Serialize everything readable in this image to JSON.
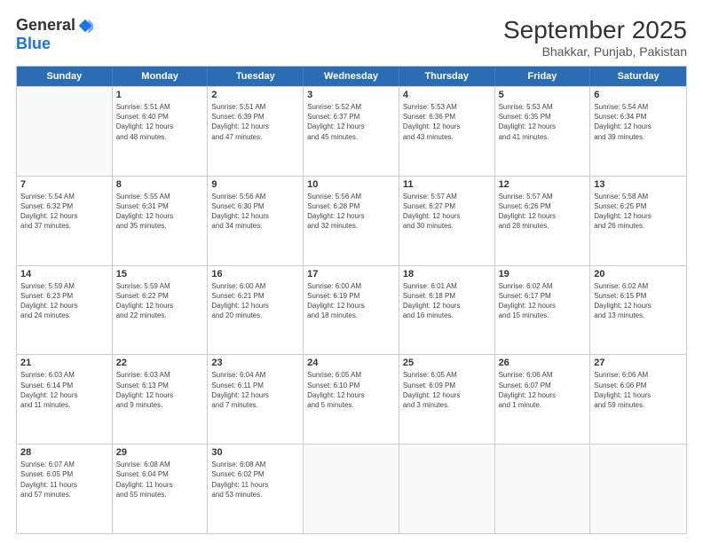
{
  "header": {
    "logo_general": "General",
    "logo_blue": "Blue",
    "month_title": "September 2025",
    "subtitle": "Bhakkar, Punjab, Pakistan"
  },
  "days_of_week": [
    "Sunday",
    "Monday",
    "Tuesday",
    "Wednesday",
    "Thursday",
    "Friday",
    "Saturday"
  ],
  "weeks": [
    [
      {
        "day": "",
        "lines": []
      },
      {
        "day": "1",
        "lines": [
          "Sunrise: 5:51 AM",
          "Sunset: 6:40 PM",
          "Daylight: 12 hours",
          "and 48 minutes."
        ]
      },
      {
        "day": "2",
        "lines": [
          "Sunrise: 5:51 AM",
          "Sunset: 6:39 PM",
          "Daylight: 12 hours",
          "and 47 minutes."
        ]
      },
      {
        "day": "3",
        "lines": [
          "Sunrise: 5:52 AM",
          "Sunset: 6:37 PM",
          "Daylight: 12 hours",
          "and 45 minutes."
        ]
      },
      {
        "day": "4",
        "lines": [
          "Sunrise: 5:53 AM",
          "Sunset: 6:36 PM",
          "Daylight: 12 hours",
          "and 43 minutes."
        ]
      },
      {
        "day": "5",
        "lines": [
          "Sunrise: 5:53 AM",
          "Sunset: 6:35 PM",
          "Daylight: 12 hours",
          "and 41 minutes."
        ]
      },
      {
        "day": "6",
        "lines": [
          "Sunrise: 5:54 AM",
          "Sunset: 6:34 PM",
          "Daylight: 12 hours",
          "and 39 minutes."
        ]
      }
    ],
    [
      {
        "day": "7",
        "lines": [
          "Sunrise: 5:54 AM",
          "Sunset: 6:32 PM",
          "Daylight: 12 hours",
          "and 37 minutes."
        ]
      },
      {
        "day": "8",
        "lines": [
          "Sunrise: 5:55 AM",
          "Sunset: 6:31 PM",
          "Daylight: 12 hours",
          "and 35 minutes."
        ]
      },
      {
        "day": "9",
        "lines": [
          "Sunrise: 5:56 AM",
          "Sunset: 6:30 PM",
          "Daylight: 12 hours",
          "and 34 minutes."
        ]
      },
      {
        "day": "10",
        "lines": [
          "Sunrise: 5:56 AM",
          "Sunset: 6:28 PM",
          "Daylight: 12 hours",
          "and 32 minutes."
        ]
      },
      {
        "day": "11",
        "lines": [
          "Sunrise: 5:57 AM",
          "Sunset: 6:27 PM",
          "Daylight: 12 hours",
          "and 30 minutes."
        ]
      },
      {
        "day": "12",
        "lines": [
          "Sunrise: 5:57 AM",
          "Sunset: 6:26 PM",
          "Daylight: 12 hours",
          "and 28 minutes."
        ]
      },
      {
        "day": "13",
        "lines": [
          "Sunrise: 5:58 AM",
          "Sunset: 6:25 PM",
          "Daylight: 12 hours",
          "and 26 minutes."
        ]
      }
    ],
    [
      {
        "day": "14",
        "lines": [
          "Sunrise: 5:59 AM",
          "Sunset: 6:23 PM",
          "Daylight: 12 hours",
          "and 24 minutes."
        ]
      },
      {
        "day": "15",
        "lines": [
          "Sunrise: 5:59 AM",
          "Sunset: 6:22 PM",
          "Daylight: 12 hours",
          "and 22 minutes."
        ]
      },
      {
        "day": "16",
        "lines": [
          "Sunrise: 6:00 AM",
          "Sunset: 6:21 PM",
          "Daylight: 12 hours",
          "and 20 minutes."
        ]
      },
      {
        "day": "17",
        "lines": [
          "Sunrise: 6:00 AM",
          "Sunset: 6:19 PM",
          "Daylight: 12 hours",
          "and 18 minutes."
        ]
      },
      {
        "day": "18",
        "lines": [
          "Sunrise: 6:01 AM",
          "Sunset: 6:18 PM",
          "Daylight: 12 hours",
          "and 16 minutes."
        ]
      },
      {
        "day": "19",
        "lines": [
          "Sunrise: 6:02 AM",
          "Sunset: 6:17 PM",
          "Daylight: 12 hours",
          "and 15 minutes."
        ]
      },
      {
        "day": "20",
        "lines": [
          "Sunrise: 6:02 AM",
          "Sunset: 6:15 PM",
          "Daylight: 12 hours",
          "and 13 minutes."
        ]
      }
    ],
    [
      {
        "day": "21",
        "lines": [
          "Sunrise: 6:03 AM",
          "Sunset: 6:14 PM",
          "Daylight: 12 hours",
          "and 11 minutes."
        ]
      },
      {
        "day": "22",
        "lines": [
          "Sunrise: 6:03 AM",
          "Sunset: 6:13 PM",
          "Daylight: 12 hours",
          "and 9 minutes."
        ]
      },
      {
        "day": "23",
        "lines": [
          "Sunrise: 6:04 AM",
          "Sunset: 6:11 PM",
          "Daylight: 12 hours",
          "and 7 minutes."
        ]
      },
      {
        "day": "24",
        "lines": [
          "Sunrise: 6:05 AM",
          "Sunset: 6:10 PM",
          "Daylight: 12 hours",
          "and 5 minutes."
        ]
      },
      {
        "day": "25",
        "lines": [
          "Sunrise: 6:05 AM",
          "Sunset: 6:09 PM",
          "Daylight: 12 hours",
          "and 3 minutes."
        ]
      },
      {
        "day": "26",
        "lines": [
          "Sunrise: 6:06 AM",
          "Sunset: 6:07 PM",
          "Daylight: 12 hours",
          "and 1 minute."
        ]
      },
      {
        "day": "27",
        "lines": [
          "Sunrise: 6:06 AM",
          "Sunset: 6:06 PM",
          "Daylight: 11 hours",
          "and 59 minutes."
        ]
      }
    ],
    [
      {
        "day": "28",
        "lines": [
          "Sunrise: 6:07 AM",
          "Sunset: 6:05 PM",
          "Daylight: 11 hours",
          "and 57 minutes."
        ]
      },
      {
        "day": "29",
        "lines": [
          "Sunrise: 6:08 AM",
          "Sunset: 6:04 PM",
          "Daylight: 11 hours",
          "and 55 minutes."
        ]
      },
      {
        "day": "30",
        "lines": [
          "Sunrise: 6:08 AM",
          "Sunset: 6:02 PM",
          "Daylight: 11 hours",
          "and 53 minutes."
        ]
      },
      {
        "day": "",
        "lines": []
      },
      {
        "day": "",
        "lines": []
      },
      {
        "day": "",
        "lines": []
      },
      {
        "day": "",
        "lines": []
      }
    ]
  ]
}
